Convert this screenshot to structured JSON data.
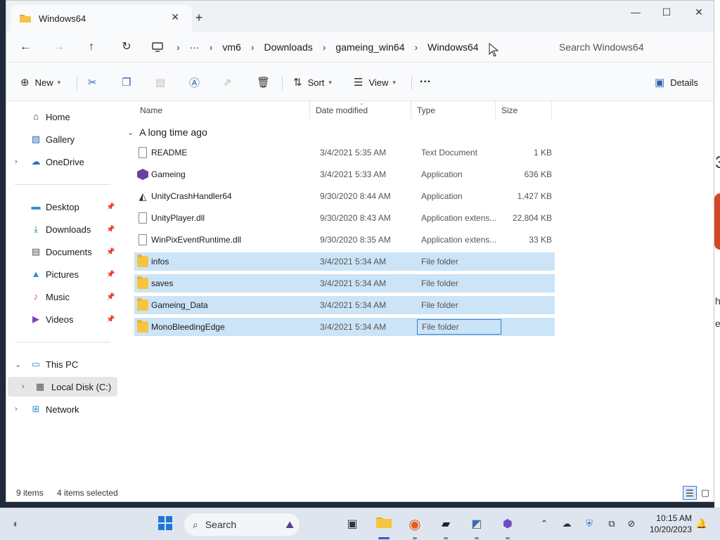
{
  "window": {
    "tab_title": "Windows64",
    "new_tab": "+",
    "close_tab": "✕",
    "minimize": "—",
    "maximize": "☐",
    "close": "✕"
  },
  "address": {
    "crumbs": [
      "vm6",
      "Downloads",
      "gameing_win64",
      "Windows64"
    ],
    "overflow": "···",
    "search_placeholder": "Search Windows64"
  },
  "commands": {
    "new": "New",
    "sort": "Sort",
    "view": "View",
    "more": "···",
    "details": "Details"
  },
  "sidebar": {
    "home": "Home",
    "gallery": "Gallery",
    "onedrive": "OneDrive",
    "quick": [
      {
        "label": "Desktop"
      },
      {
        "label": "Downloads"
      },
      {
        "label": "Documents"
      },
      {
        "label": "Pictures"
      },
      {
        "label": "Music"
      },
      {
        "label": "Videos"
      }
    ],
    "this_pc": "This PC",
    "local_disk": "Local Disk (C:)",
    "network": "Network"
  },
  "columns": {
    "name": "Name",
    "date": "Date modified",
    "type": "Type",
    "size": "Size"
  },
  "group": "A long time ago",
  "files": [
    {
      "name": "README",
      "date": "3/4/2021 5:35 AM",
      "type": "Text Document",
      "size": "1 KB",
      "icon": "document-icon"
    },
    {
      "name": "Gameing",
      "date": "3/4/2021 5:33 AM",
      "type": "Application",
      "size": "636 KB",
      "icon": "app-icon"
    },
    {
      "name": "UnityCrashHandler64",
      "date": "9/30/2020 8:44 AM",
      "type": "Application",
      "size": "1,427 KB",
      "icon": "unity-icon"
    },
    {
      "name": "UnityPlayer.dll",
      "date": "9/30/2020 8:43 AM",
      "type": "Application extens...",
      "size": "22,804 KB",
      "icon": "dll-icon"
    },
    {
      "name": "WinPixEventRuntime.dll",
      "date": "9/30/2020 8:35 AM",
      "type": "Application extens...",
      "size": "33 KB",
      "icon": "dll-icon"
    },
    {
      "name": "infos",
      "date": "3/4/2021 5:34 AM",
      "type": "File folder",
      "size": "",
      "icon": "folder-icon"
    },
    {
      "name": "saves",
      "date": "3/4/2021 5:34 AM",
      "type": "File folder",
      "size": "",
      "icon": "folder-icon"
    },
    {
      "name": "Gameing_Data",
      "date": "3/4/2021 5:34 AM",
      "type": "File folder",
      "size": "",
      "icon": "folder-icon"
    },
    {
      "name": "MonoBleedingEdge",
      "date": "3/4/2021 5:34 AM",
      "type": "File folder",
      "size": "",
      "icon": "folder-icon"
    }
  ],
  "status": {
    "count": "9 items",
    "selected": "4 items selected"
  },
  "taskbar": {
    "search": "Search",
    "time": "10:15 AM",
    "date": "10/20/2023"
  },
  "colors": {
    "selection": "#cce4f7",
    "accent": "#2b63b5",
    "folder": "#f5c542"
  }
}
